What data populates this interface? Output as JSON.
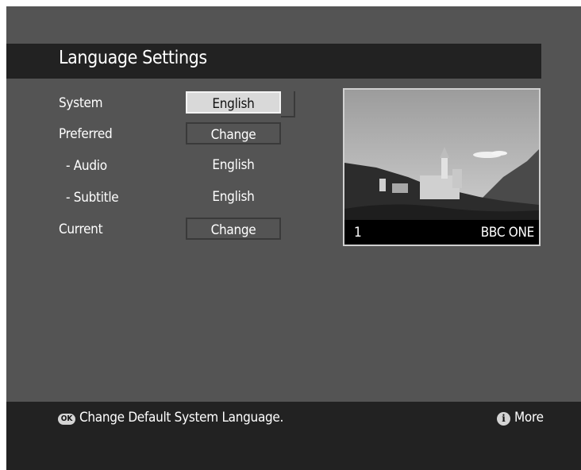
{
  "header": {
    "title": "Language Settings"
  },
  "settings": {
    "system": {
      "label": "System",
      "value": "English"
    },
    "preferred": {
      "label": "Preferred",
      "value": "Change"
    },
    "audio": {
      "label": "- Audio",
      "value": "English"
    },
    "subtitle": {
      "label": "- Subtitle",
      "value": "English"
    },
    "current": {
      "label": "Current",
      "value": "Change"
    }
  },
  "preview": {
    "channel_number": "1",
    "channel_name": "BBC ONE"
  },
  "footer": {
    "ok_icon": "OK",
    "hint": "Change Default System Language.",
    "info_icon": "i",
    "more_label": "More"
  },
  "colors": {
    "background": "#545454",
    "bars": "#222222",
    "selected": "#d9d9d9"
  }
}
